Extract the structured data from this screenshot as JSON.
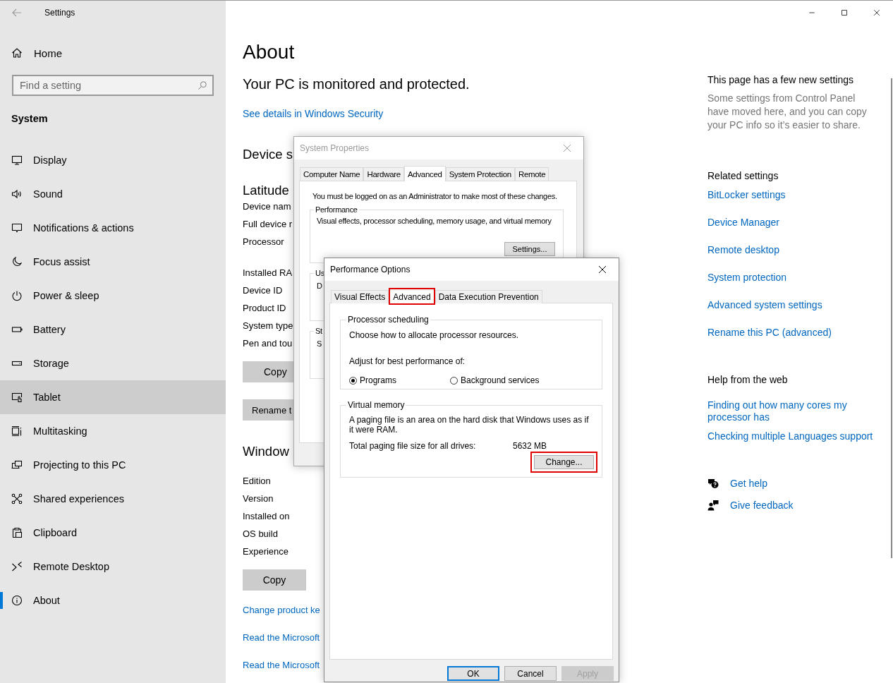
{
  "window": {
    "title": "Settings"
  },
  "sidebar": {
    "home": "Home",
    "search": {
      "placeholder": "Find a setting"
    },
    "section": "System",
    "items": [
      {
        "label": "Display",
        "kind": "display",
        "selected": false,
        "hovered": false
      },
      {
        "label": "Sound",
        "kind": "sound",
        "selected": false,
        "hovered": false
      },
      {
        "label": "Notifications & actions",
        "kind": "notifications",
        "selected": false,
        "hovered": false
      },
      {
        "label": "Focus assist",
        "kind": "focus",
        "selected": false,
        "hovered": false
      },
      {
        "label": "Power & sleep",
        "kind": "power",
        "selected": false,
        "hovered": false
      },
      {
        "label": "Battery",
        "kind": "battery",
        "selected": false,
        "hovered": false
      },
      {
        "label": "Storage",
        "kind": "storage",
        "selected": false,
        "hovered": false
      },
      {
        "label": "Tablet",
        "kind": "tablet",
        "selected": false,
        "hovered": true
      },
      {
        "label": "Multitasking",
        "kind": "multitasking",
        "selected": false,
        "hovered": false
      },
      {
        "label": "Projecting to this PC",
        "kind": "projecting",
        "selected": false,
        "hovered": false
      },
      {
        "label": "Shared experiences",
        "kind": "shared",
        "selected": false,
        "hovered": false
      },
      {
        "label": "Clipboard",
        "kind": "clipboard",
        "selected": false,
        "hovered": false
      },
      {
        "label": "Remote Desktop",
        "kind": "remote",
        "selected": false,
        "hovered": false
      },
      {
        "label": "About",
        "kind": "about",
        "selected": true,
        "hovered": false
      }
    ]
  },
  "main": {
    "title": "About",
    "protection_status": "Your PC is monitored and protected.",
    "security_link": "See details in Windows Security",
    "device_specs": {
      "heading": "Device s",
      "device_model": "Latitude",
      "labels": [
        "Device nam",
        "Full device r",
        "Processor",
        "Installed RA",
        "Device ID",
        "Product ID",
        "System type",
        "Pen and tou"
      ],
      "copy_button": "Copy",
      "rename_button": "Rename t"
    },
    "windows_specs": {
      "heading": "Window",
      "labels": [
        "Edition",
        "Version",
        "Installed on",
        "OS build",
        "Experience"
      ],
      "copy_button": "Copy"
    },
    "links": [
      "Change product ke",
      "Read the Microsoft",
      "Read the Microsoft"
    ]
  },
  "right_pane": {
    "new_settings": {
      "title": "This page has a few new settings",
      "description": "Some settings from Control Panel have moved here, and you can copy your PC info so it’s easier to share."
    },
    "related": {
      "title": "Related settings",
      "links": [
        "BitLocker settings",
        "Device Manager",
        "Remote desktop",
        "System protection",
        "Advanced system settings",
        "Rename this PC (advanced)"
      ]
    },
    "help": {
      "title": "Help from the web",
      "links": [
        "Finding out how many cores my processor has",
        "Checking multiple Languages support"
      ]
    },
    "support": [
      {
        "label": "Get help",
        "kind": "help"
      },
      {
        "label": "Give feedback",
        "kind": "feedback"
      }
    ]
  },
  "system_properties": {
    "title": "System Properties",
    "tabs": [
      {
        "label": "Computer Name",
        "selected": false
      },
      {
        "label": "Hardware",
        "selected": false
      },
      {
        "label": "Advanced",
        "selected": true
      },
      {
        "label": "System Protection",
        "selected": false
      },
      {
        "label": "Remote",
        "selected": false
      }
    ],
    "notice": "You must be logged on as an Administrator to make most of these changes.",
    "performance": {
      "title": "Performance",
      "description": "Visual effects, processor scheduling, memory usage, and virtual memory",
      "button": "Settings..."
    },
    "partial_groups": [
      {
        "title": "Us",
        "description": "D"
      },
      {
        "title": "St",
        "description": "S"
      }
    ]
  },
  "performance_options": {
    "title": "Performance Options",
    "tabs": [
      {
        "label": "Visual Effects",
        "selected": false,
        "highlighted": false
      },
      {
        "label": "Advanced",
        "selected": true,
        "highlighted": true
      },
      {
        "label": "Data Execution Prevention",
        "selected": false,
        "highlighted": false
      }
    ],
    "processor_scheduling": {
      "title": "Processor scheduling",
      "description": "Choose how to allocate processor resources.",
      "prompt": "Adjust for best performance of:",
      "options": [
        {
          "label": "Programs",
          "selected": true
        },
        {
          "label": "Background services",
          "selected": false
        }
      ]
    },
    "virtual_memory": {
      "title": "Virtual memory",
      "description": "A paging file is an area on the hard disk that Windows uses as if it were RAM.",
      "total_label": "Total paging file size for all drives:",
      "total_value": "5632 MB",
      "button": {
        "label": "Change...",
        "highlighted": true
      }
    },
    "buttons": [
      {
        "label": "OK",
        "default": true,
        "disabled": false
      },
      {
        "label": "Cancel",
        "default": false,
        "disabled": false
      },
      {
        "label": "Apply",
        "default": false,
        "disabled": true
      }
    ]
  }
}
